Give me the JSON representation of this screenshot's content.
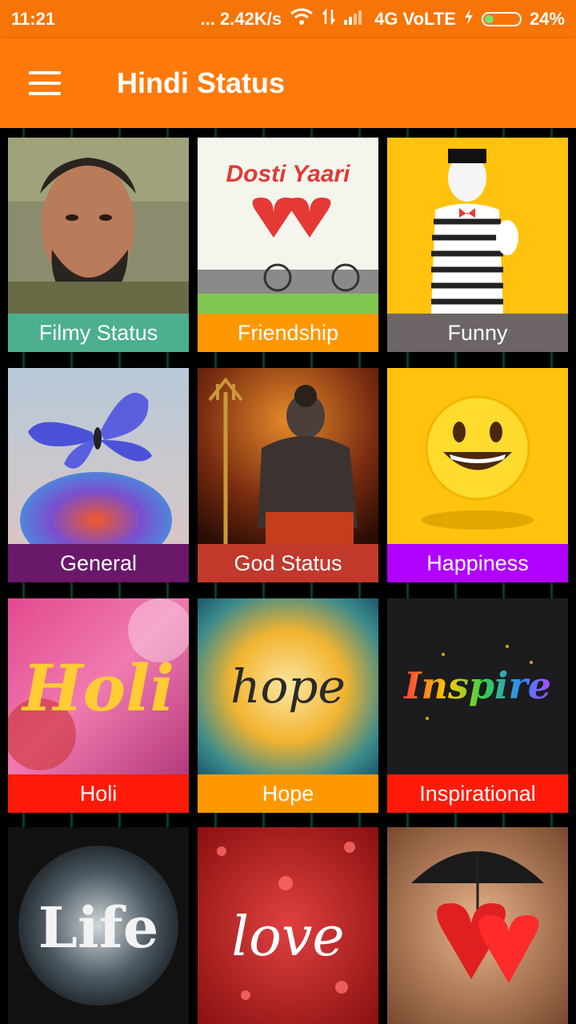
{
  "status_bar": {
    "time": "11:21",
    "speed": "... 2.42K/s",
    "network": "4G VoLTE",
    "battery": "24%",
    "battery_level": 0.24
  },
  "app_bar": {
    "title": "Hindi Status",
    "menu_icon": "hamburger-menu-icon"
  },
  "categories": [
    {
      "label": "Filmy Status",
      "color": "#4caf8f"
    },
    {
      "label": "Friendship",
      "color": "#ff9800"
    },
    {
      "label": "Funny",
      "color": "#6d6565"
    },
    {
      "label": "General",
      "color": "#6a1869"
    },
    {
      "label": "God Status",
      "color": "#c0392b"
    },
    {
      "label": "Happiness",
      "color": "#b000ff"
    },
    {
      "label": "Holi",
      "color": "#ff1a0a"
    },
    {
      "label": "Hope",
      "color": "#ff9800"
    },
    {
      "label": "Inspirational",
      "color": "#ff1a0a"
    }
  ],
  "tile_art_text": {
    "friendship": "Dosti Yaari",
    "holi": "Holi",
    "hope": "hope",
    "inspire": "Inspire",
    "life": "Life",
    "love": "love"
  }
}
